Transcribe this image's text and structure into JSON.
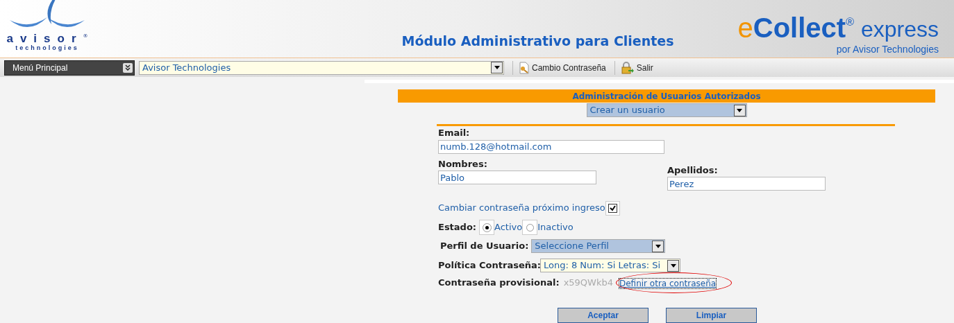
{
  "header": {
    "logo": {
      "name": "avisor",
      "mark": "®",
      "tagline": "technologies"
    },
    "title": "Módulo Administrativo para Clientes",
    "brand": {
      "prefix": "e",
      "name": "Collect",
      "mark": "®",
      "suffix": "express",
      "byline": "por Avisor Technologies"
    }
  },
  "toolbar": {
    "menu": "Menú Principal",
    "client": "Avisor Technologies",
    "buttons": [
      {
        "label": "Cambio Contraseña",
        "kind": "key"
      },
      {
        "label": "Salir",
        "kind": "exit"
      }
    ]
  },
  "form": {
    "title": "Administración de Usuarios Autorizados",
    "action": "Crear un usuario",
    "email": {
      "label": "Email:",
      "value": "numb.128@hotmail.com"
    },
    "nombres": {
      "label": "Nombres:",
      "value": "Pablo"
    },
    "apellidos": {
      "label": "Apellidos:",
      "value": "Perez"
    },
    "change_password": {
      "label": "Cambiar contraseña próximo ingreso",
      "checked": true
    },
    "estado": {
      "label": "Estado:",
      "options": [
        {
          "label": "Activo",
          "selected": true
        },
        {
          "label": "Inactivo",
          "selected": false
        }
      ]
    },
    "perfil": {
      "label": "Perfil de Usuario:",
      "value": "Seleccione Perfil"
    },
    "politica": {
      "label": "Política Contraseña:",
      "value": "Long: 8 Num: Si Letras: Si"
    },
    "provisional": {
      "label": "Contraseña provisional:",
      "value": "x59QWkb4",
      "link": "Definir otra contraseña",
      "circled": true
    },
    "buttons": [
      "Aceptar",
      "Limpiar"
    ]
  }
}
